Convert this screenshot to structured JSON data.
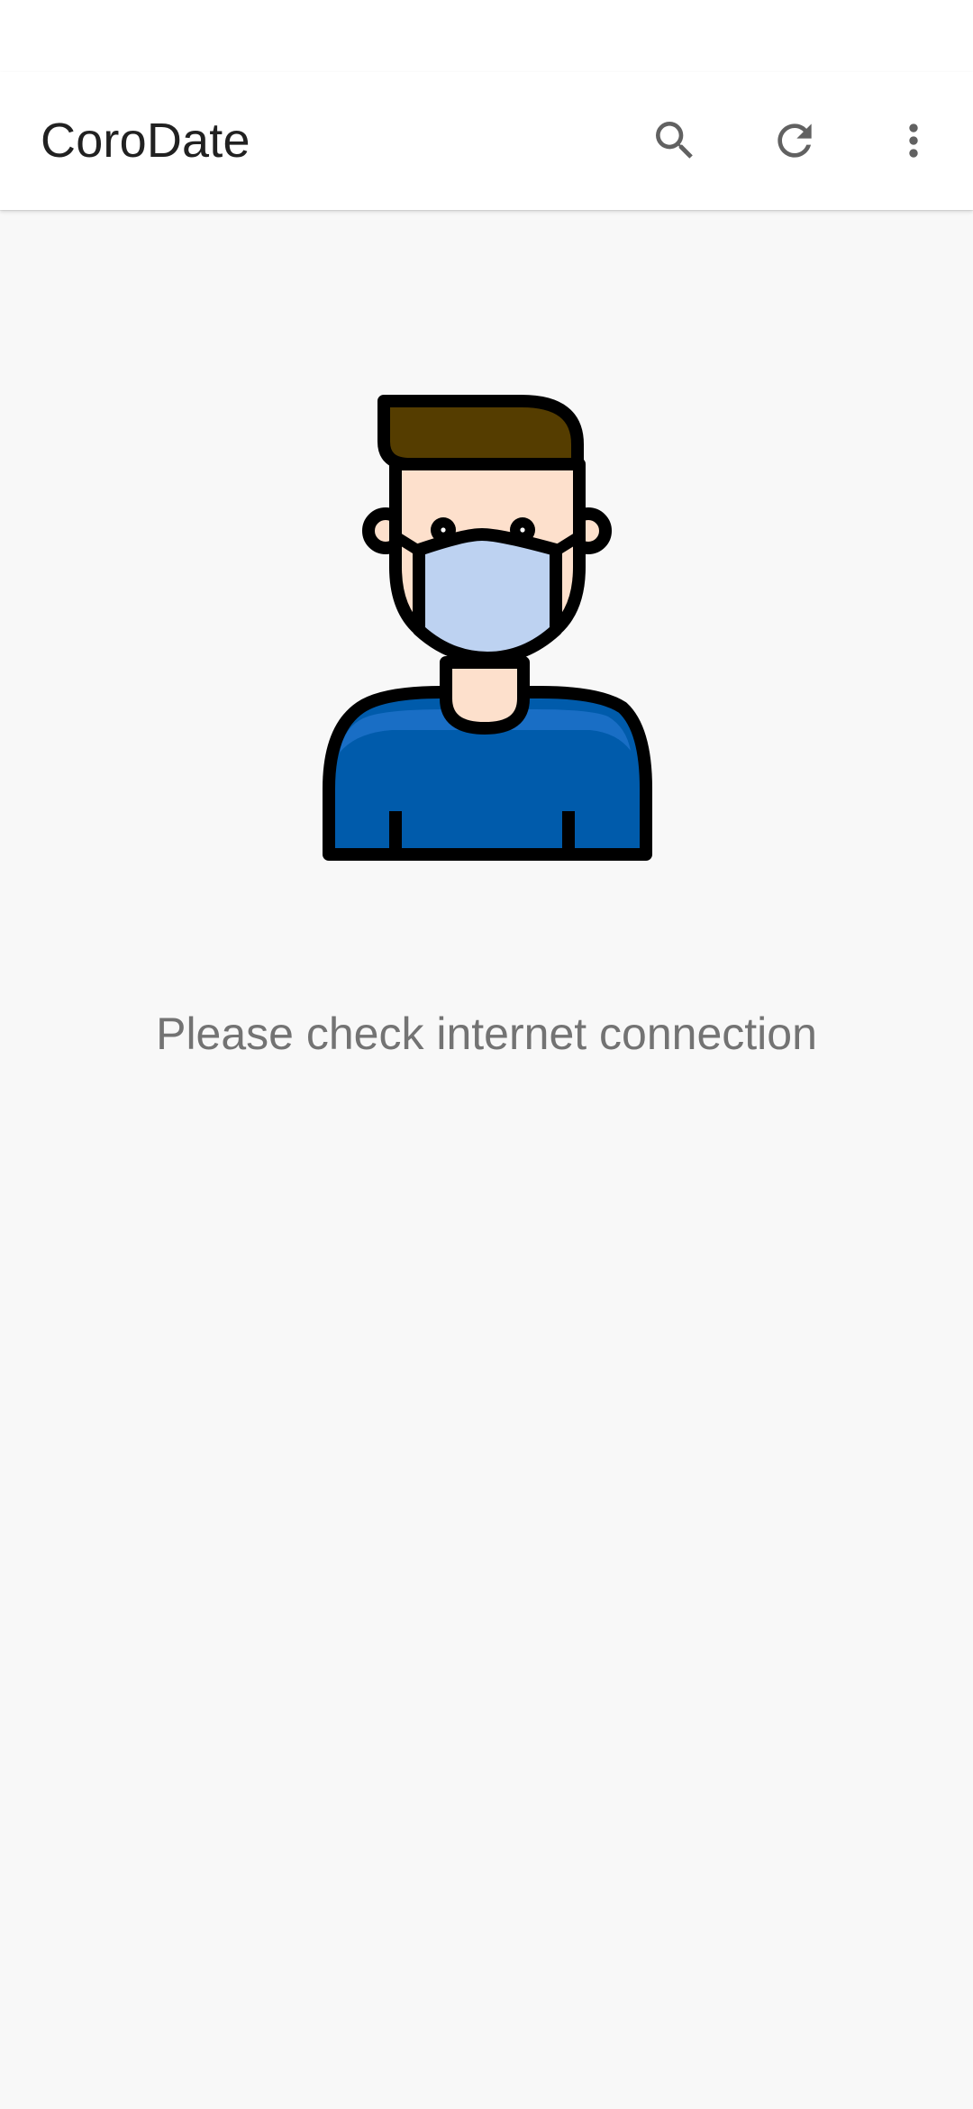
{
  "app_bar": {
    "title": "CoroDate",
    "actions": [
      {
        "name": "search",
        "icon": "search-icon"
      },
      {
        "name": "refresh",
        "icon": "refresh-icon"
      },
      {
        "name": "more",
        "icon": "more-vert-icon"
      }
    ],
    "icon_color": "#616161"
  },
  "empty_state": {
    "illustration": "masked-person-illustration",
    "message": "Please check internet connection"
  },
  "colors": {
    "background": "#f8f8f8",
    "app_bar": "#ffffff",
    "hair": "#553d00",
    "skin": "#fde0cc",
    "mask": "#bdd2f1",
    "shirt": "#005bab",
    "message_text": "#737373"
  }
}
